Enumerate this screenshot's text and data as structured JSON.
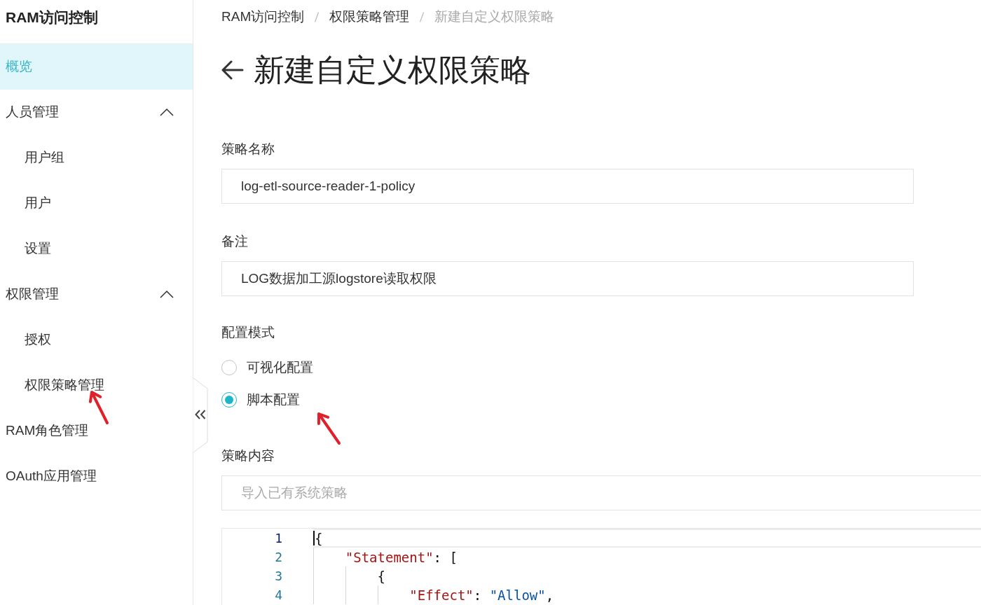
{
  "sidebar": {
    "title": "RAM访问控制",
    "items": [
      {
        "kind": "link",
        "label": "概览",
        "selected": true
      },
      {
        "kind": "group",
        "label": "人员管理",
        "selected": false,
        "expanded": true,
        "children": [
          {
            "kind": "link",
            "label": "用户组",
            "selected": false
          },
          {
            "kind": "link",
            "label": "用户",
            "selected": false
          },
          {
            "kind": "link",
            "label": "设置",
            "selected": false
          }
        ]
      },
      {
        "kind": "group",
        "label": "权限管理",
        "selected": false,
        "expanded": true,
        "children": [
          {
            "kind": "link",
            "label": "授权",
            "selected": false
          },
          {
            "kind": "link",
            "label": "权限策略管理",
            "selected": false
          }
        ]
      },
      {
        "kind": "link",
        "label": "RAM角色管理",
        "selected": false
      },
      {
        "kind": "link",
        "label": "OAuth应用管理",
        "selected": false
      }
    ]
  },
  "breadcrumb": [
    {
      "label": "RAM访问控制",
      "current": false
    },
    {
      "label": "权限策略管理",
      "current": false
    },
    {
      "label": "新建自定义权限策略",
      "current": true
    }
  ],
  "page_title": "新建自定义权限策略",
  "form": {
    "fields": [
      {
        "kind": "text",
        "label": "策略名称",
        "value": "log-etl-source-reader-1-policy"
      },
      {
        "kind": "text",
        "label": "备注",
        "value": "LOG数据加工源logstore读取权限"
      },
      {
        "kind": "radio",
        "label": "配置模式",
        "options": [
          {
            "label": "可视化配置",
            "selected": false
          },
          {
            "label": "脚本配置",
            "selected": true
          }
        ]
      },
      {
        "kind": "script",
        "label": "策略内容",
        "placeholder": "导入已有系统策略",
        "editor": {
          "lines": [
            {
              "number": "1",
              "active": true,
              "tokens": [
                {
                  "kind": "punct",
                  "text": "{"
                }
              ]
            },
            {
              "number": "2",
              "active": false,
              "tokens": [
                {
                  "kind": "key",
                  "text": "    \"Statement\""
                },
                {
                  "kind": "punct",
                  "text": ": ["
                }
              ]
            },
            {
              "number": "3",
              "active": false,
              "tokens": [
                {
                  "kind": "punct",
                  "text": "        {"
                }
              ]
            },
            {
              "number": "4",
              "active": false,
              "tokens": [
                {
                  "kind": "key",
                  "text": "            \"Effect\""
                },
                {
                  "kind": "punct",
                  "text": ": "
                },
                {
                  "kind": "string",
                  "text": "\"Allow\""
                },
                {
                  "kind": "punct",
                  "text": ","
                }
              ]
            }
          ]
        }
      }
    ]
  }
}
